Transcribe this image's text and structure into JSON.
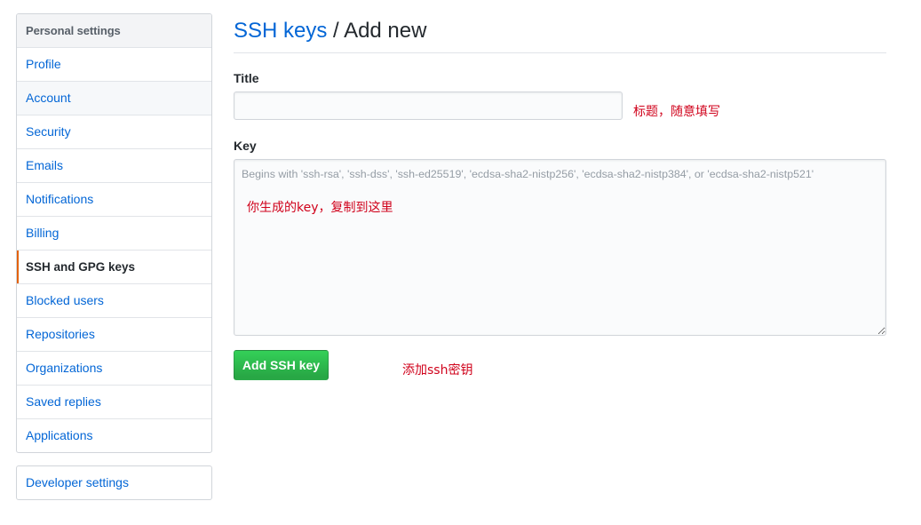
{
  "sidebar": {
    "heading": "Personal settings",
    "items": [
      {
        "label": "Profile"
      },
      {
        "label": "Account"
      },
      {
        "label": "Security"
      },
      {
        "label": "Emails"
      },
      {
        "label": "Notifications"
      },
      {
        "label": "Billing"
      },
      {
        "label": "SSH and GPG keys"
      },
      {
        "label": "Blocked users"
      },
      {
        "label": "Repositories"
      },
      {
        "label": "Organizations"
      },
      {
        "label": "Saved replies"
      },
      {
        "label": "Applications"
      }
    ],
    "selected": "SSH and GPG keys",
    "developer_settings": "Developer settings"
  },
  "header": {
    "breadcrumb_link": "SSH keys",
    "separator": " / ",
    "current": "Add new"
  },
  "form": {
    "title_label": "Title",
    "title_value": "",
    "key_label": "Key",
    "key_placeholder": "Begins with 'ssh-rsa', 'ssh-dss', 'ssh-ed25519', 'ecdsa-sha2-nistp256', 'ecdsa-sha2-nistp384', or 'ecdsa-sha2-nistp521'",
    "submit_label": "Add SSH key"
  },
  "annotations": {
    "title_note": "标题，随意填写",
    "key_note": "你生成的key，复制到这里",
    "button_note": "添加ssh密钥"
  },
  "colors": {
    "link": "#0366d6",
    "accent_selected": "#e36209",
    "primary_button": "#28a745",
    "annotation": "#d0021b"
  }
}
